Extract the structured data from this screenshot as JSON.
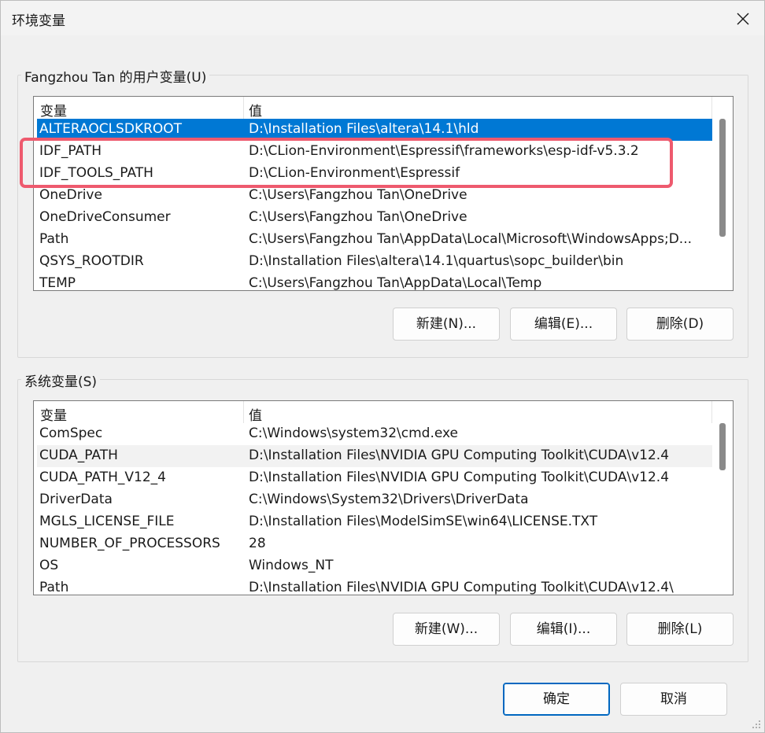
{
  "window": {
    "title": "环境变量"
  },
  "user_vars": {
    "group_label": "Fangzhou Tan 的用户变量(U)",
    "col_name": "变量",
    "col_value": "值",
    "rows": [
      {
        "name": "ALTERAOCLSDKROOT",
        "value": "D:\\Installation Files\\altera\\14.1\\hld",
        "state": "selected"
      },
      {
        "name": "IDF_PATH",
        "value": "D:\\CLion-Environment\\Espressif\\frameworks\\esp-idf-v5.3.2",
        "state": ""
      },
      {
        "name": "IDF_TOOLS_PATH",
        "value": "D:\\CLion-Environment\\Espressif",
        "state": ""
      },
      {
        "name": "OneDrive",
        "value": "C:\\Users\\Fangzhou Tan\\OneDrive",
        "state": ""
      },
      {
        "name": "OneDriveConsumer",
        "value": "C:\\Users\\Fangzhou Tan\\OneDrive",
        "state": ""
      },
      {
        "name": "Path",
        "value": "C:\\Users\\Fangzhou Tan\\AppData\\Local\\Microsoft\\WindowsApps;D...",
        "state": ""
      },
      {
        "name": "QSYS_ROOTDIR",
        "value": "D:\\Installation Files\\altera\\14.1\\quartus\\sopc_builder\\bin",
        "state": ""
      },
      {
        "name": "TEMP",
        "value": "C:\\Users\\Fangzhou Tan\\AppData\\Local\\Temp",
        "state": ""
      }
    ],
    "buttons": {
      "new": "新建(N)...",
      "edit": "编辑(E)...",
      "delete": "删除(D)"
    }
  },
  "system_vars": {
    "group_label": "系统变量(S)",
    "col_name": "变量",
    "col_value": "值",
    "rows": [
      {
        "name": "ComSpec",
        "value": "C:\\Windows\\system32\\cmd.exe",
        "state": ""
      },
      {
        "name": "CUDA_PATH",
        "value": "D:\\Installation Files\\NVIDIA GPU Computing Toolkit\\CUDA\\v12.4",
        "state": "hover"
      },
      {
        "name": "CUDA_PATH_V12_4",
        "value": "D:\\Installation Files\\NVIDIA GPU Computing Toolkit\\CUDA\\v12.4",
        "state": ""
      },
      {
        "name": "DriverData",
        "value": "C:\\Windows\\System32\\Drivers\\DriverData",
        "state": ""
      },
      {
        "name": "MGLS_LICENSE_FILE",
        "value": "D:\\Installation Files\\ModelSimSE\\win64\\LICENSE.TXT",
        "state": ""
      },
      {
        "name": "NUMBER_OF_PROCESSORS",
        "value": "28",
        "state": ""
      },
      {
        "name": "OS",
        "value": "Windows_NT",
        "state": ""
      },
      {
        "name": "Path",
        "value": "D:\\Installation Files\\NVIDIA GPU Computing Toolkit\\CUDA\\v12.4\\",
        "state": ""
      }
    ],
    "buttons": {
      "new": "新建(W)...",
      "edit": "编辑(I)...",
      "delete": "删除(L)"
    }
  },
  "footer": {
    "ok": "确定",
    "cancel": "取消"
  },
  "colors": {
    "selection": "#0078d4",
    "highlight_box": "#ee5a6e",
    "primary_border": "#0067c0"
  }
}
